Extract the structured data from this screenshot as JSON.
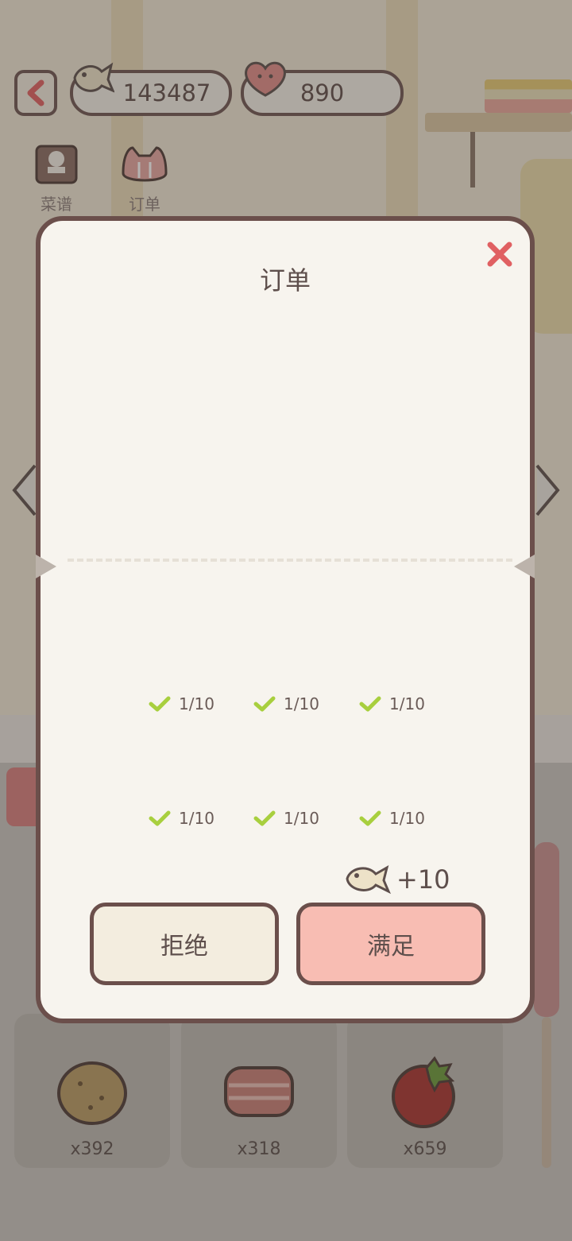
{
  "hud": {
    "back_icon": "chevron-left-icon",
    "fish_currency": "143487",
    "heart_currency": "890"
  },
  "toolbar": {
    "recipe_label": "菜谱",
    "order_label": "订单"
  },
  "modal": {
    "title": "订单",
    "requirements": [
      {
        "progress": "1/10",
        "done": true
      },
      {
        "progress": "1/10",
        "done": true
      },
      {
        "progress": "1/10",
        "done": true
      },
      {
        "progress": "1/10",
        "done": true
      },
      {
        "progress": "1/10",
        "done": true
      },
      {
        "progress": "1/10",
        "done": true
      }
    ],
    "reward": "+10",
    "reject_label": "拒绝",
    "accept_label": "满足"
  },
  "inventory": [
    {
      "name": "potato-icon",
      "count": "x392"
    },
    {
      "name": "bacon-icon",
      "count": "x318"
    },
    {
      "name": "tomato-icon",
      "count": "x659"
    }
  ],
  "colors": {
    "outline": "#6b4f4b",
    "accept": "#f8bdb3",
    "close": "#e06062",
    "check": "#a8cf3e"
  }
}
